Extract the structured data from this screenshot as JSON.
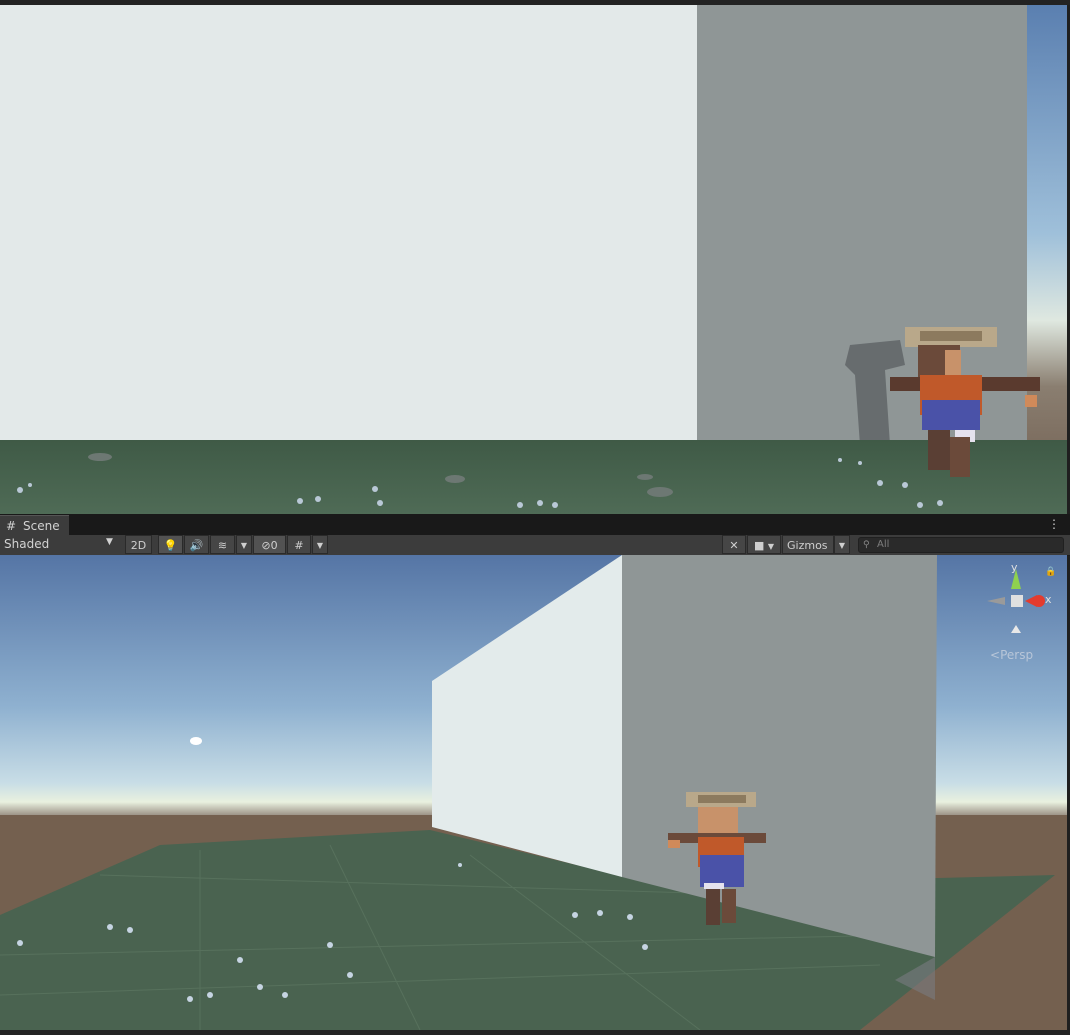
{
  "scene_tab": {
    "label": "Scene",
    "icon": "grid-icon"
  },
  "toolbar": {
    "shading_mode": "Shaded",
    "two_d_label": "2D",
    "hidden_count": "0",
    "gizmos_label": "Gizmos",
    "search_placeholder": "All"
  },
  "gizmo": {
    "y_label": "y",
    "x_label": "x",
    "projection": "Persp"
  },
  "colors": {
    "accent_green": "#8fd14f",
    "accent_red": "#e33b2e",
    "panel_bg": "#3c3c3c",
    "ground_green": "#4a6350",
    "wall_light": "#e6eaea",
    "wall_dark": "#8f9696"
  }
}
